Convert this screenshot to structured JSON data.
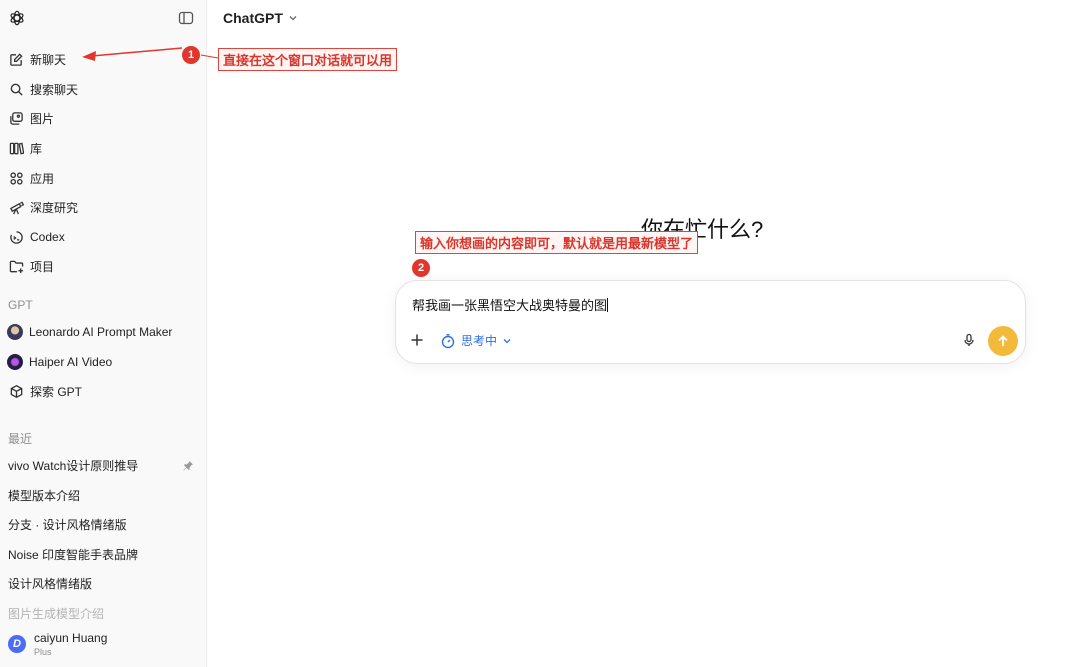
{
  "header": {
    "model_label": "ChatGPT"
  },
  "sidebar": {
    "nav": [
      {
        "label": "新聊天",
        "icon": "edit-icon"
      },
      {
        "label": "搜索聊天",
        "icon": "search-icon"
      },
      {
        "label": "图片",
        "icon": "images-icon"
      },
      {
        "label": "库",
        "icon": "library-icon"
      },
      {
        "label": "应用",
        "icon": "apps-icon"
      },
      {
        "label": "深度研究",
        "icon": "telescope-icon"
      },
      {
        "label": "Codex",
        "icon": "codex-icon"
      },
      {
        "label": "项目",
        "icon": "folder-plus-icon"
      }
    ],
    "gpt_section_label": "GPT",
    "gpts": [
      {
        "label": "Leonardo AI Prompt Maker",
        "icon": "leonardo-avatar"
      },
      {
        "label": "Haiper AI Video",
        "icon": "haiper-avatar"
      },
      {
        "label": "探索 GPT",
        "icon": "cube-icon"
      }
    ],
    "recent_section_label": "最近",
    "recent": [
      "vivo Watch设计原则推导",
      "模型版本介绍",
      "分支 · 设计风格情绪版",
      "Noise 印度智能手表品牌",
      "设计风格情绪版",
      "图片生成模型介绍"
    ],
    "user": {
      "initial": "D",
      "name": "caiyun Huang",
      "plan": "Plus"
    }
  },
  "main": {
    "hero": "你在忙什么?",
    "composer": {
      "text": "帮我画一张黑悟空大战奥特曼的图",
      "mode_label": "思考中"
    }
  },
  "annotations": [
    {
      "number": "1",
      "text": "直接在这个窗口对话就可以用"
    },
    {
      "number": "2",
      "text": "输入你想画的内容即可，默认就是用最新模型了"
    }
  ],
  "colors": {
    "accent": "#2f6fdf",
    "send": "#f2b93b",
    "annotation": "#e0362b",
    "sidebar_bg": "#f9f9f9"
  }
}
